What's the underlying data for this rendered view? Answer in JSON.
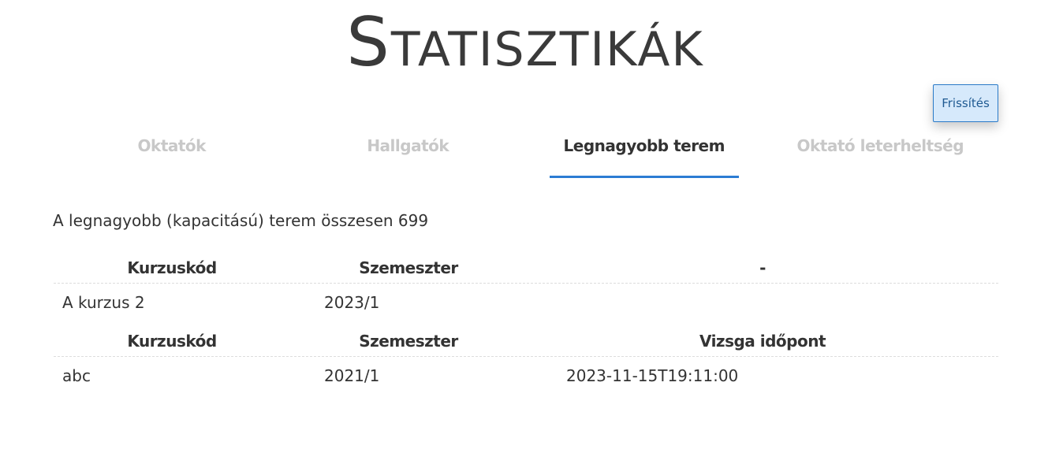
{
  "page": {
    "title": "Statisztikák"
  },
  "refresh": {
    "label": "Frissítés"
  },
  "tabs": [
    {
      "label": "Oktatók"
    },
    {
      "label": "Hallgatók"
    },
    {
      "label": "Legnagyobb terem"
    },
    {
      "label": "Oktató leterheltség"
    }
  ],
  "active_tab": "Legnagyobb terem",
  "summary": {
    "text": "A legnagyobb (kapacitású) terem összesen 699"
  },
  "table1": {
    "headers": [
      "Kurzuskód",
      "Szemeszter",
      "-"
    ],
    "rows": [
      [
        "A kurzus 2",
        "2023/1",
        ""
      ]
    ]
  },
  "table2": {
    "headers": [
      "Kurzuskód",
      "Szemeszter",
      "Vizsga időpont"
    ],
    "rows": [
      [
        "abc",
        "2021/1",
        "2023-11-15T19:11:00"
      ]
    ]
  },
  "colors": {
    "accent": "#2b7cd3",
    "button_bg": "#d6e9fb",
    "inactive_tab": "#c8c8c8",
    "text": "#333333"
  }
}
